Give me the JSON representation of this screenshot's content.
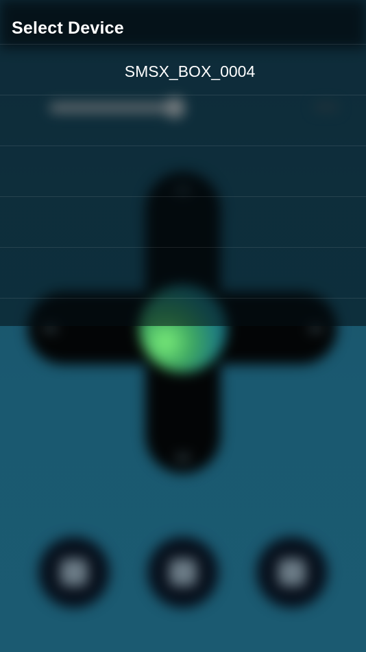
{
  "device_picker": {
    "title": "Select Device",
    "devices": [
      {
        "name": "SMSX_BOX_0004"
      },
      {
        "name": ""
      },
      {
        "name": ""
      },
      {
        "name": ""
      },
      {
        "name": ""
      }
    ]
  },
  "remote": {
    "icons": {
      "dpad_up": "chevron-up-icon",
      "dpad_down": "chevron-down-icon",
      "dpad_left": "chevron-left-icon",
      "dpad_right": "chevron-right-icon",
      "button_1": "phone-icon",
      "button_2": "keyboard-icon",
      "button_3": "home-icon"
    }
  },
  "colors": {
    "background": "#1b5168",
    "dpad": "#030506",
    "center_glow": "#7df07a",
    "overlay_text": "#ffffff"
  }
}
